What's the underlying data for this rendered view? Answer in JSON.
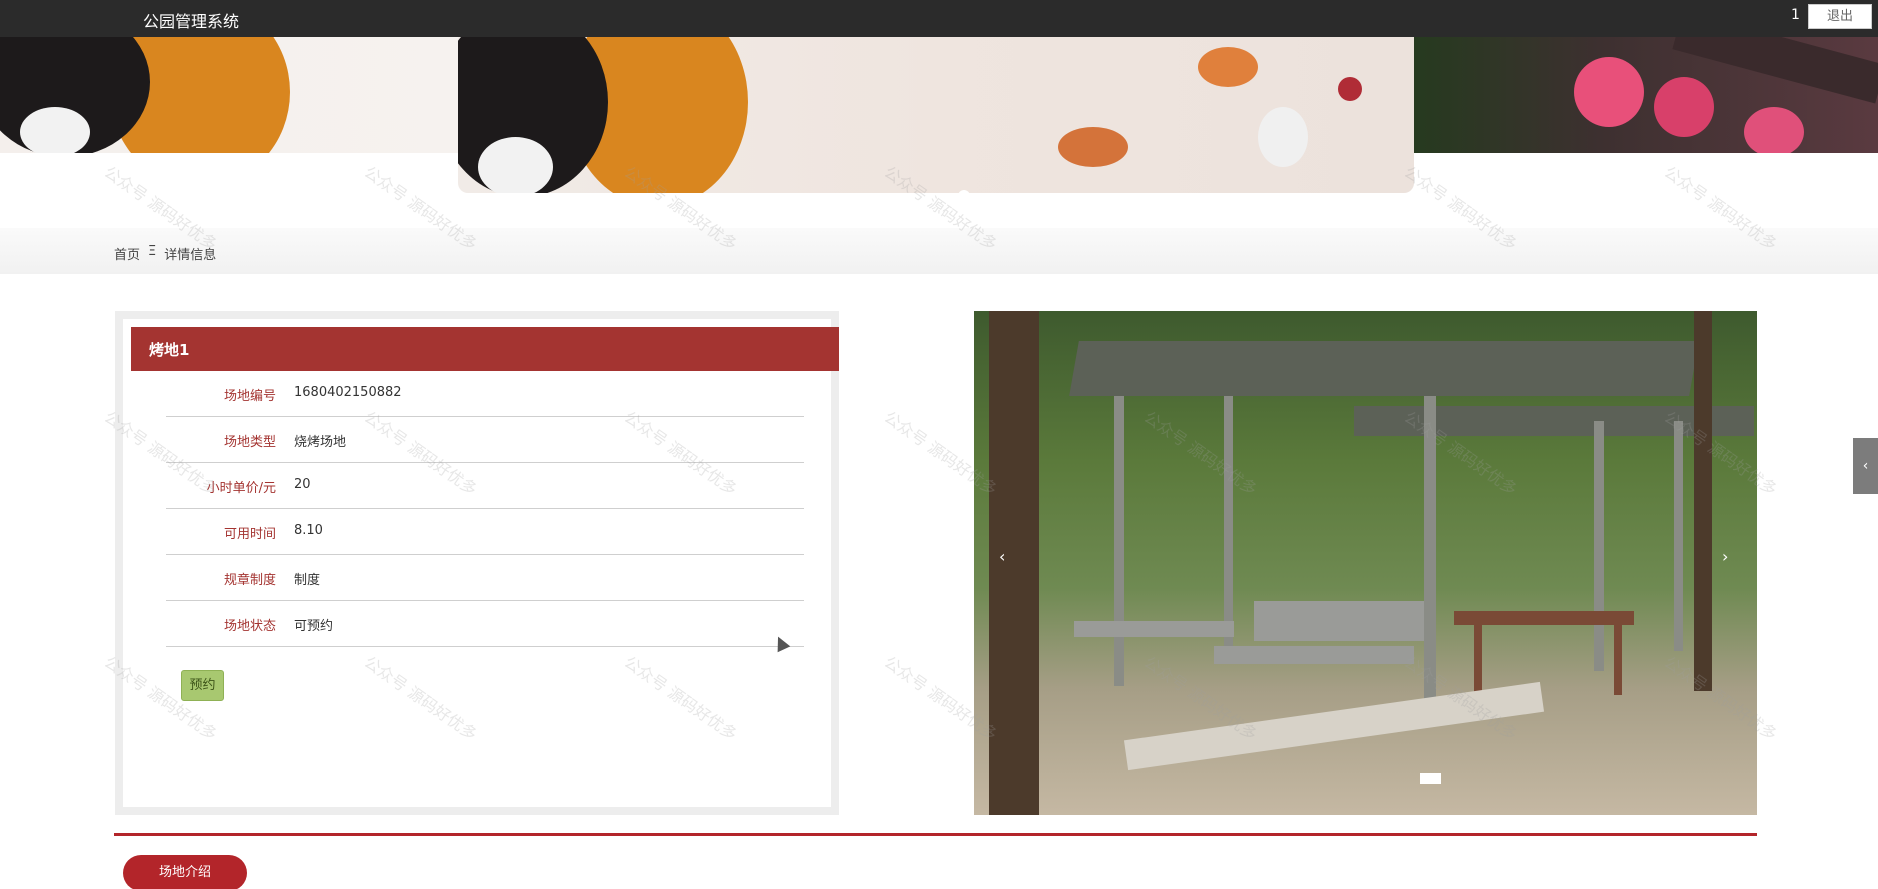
{
  "header": {
    "title": "公园管理系统",
    "user": "1",
    "logout_label": "退出"
  },
  "breadcrumb": {
    "home": "首页",
    "separator": "Ξ",
    "current": "详情信息"
  },
  "detail": {
    "name": "烤地1",
    "fields": [
      {
        "label": "场地编号",
        "value": "1680402150882"
      },
      {
        "label": "场地类型",
        "value": "烧烤场地"
      },
      {
        "label": "小时单价/元",
        "value": "20"
      },
      {
        "label": "可用时间",
        "value": "8.10"
      },
      {
        "label": "规章制度",
        "value": "制度"
      },
      {
        "label": "场地状态",
        "value": "可预约"
      }
    ],
    "book_label": "预约"
  },
  "carousel": {
    "prev_icon": "chevron-left-icon",
    "next_icon": "chevron-right-icon"
  },
  "side_tab_icon": "chevron-left-icon",
  "intro_tab_label": "场地介绍",
  "watermark": "公众号 源码好优多",
  "colors": {
    "topbar": "#2b2b2b",
    "accent": "#a43431",
    "divider": "#b3252a",
    "book_button": "#a8c870"
  }
}
